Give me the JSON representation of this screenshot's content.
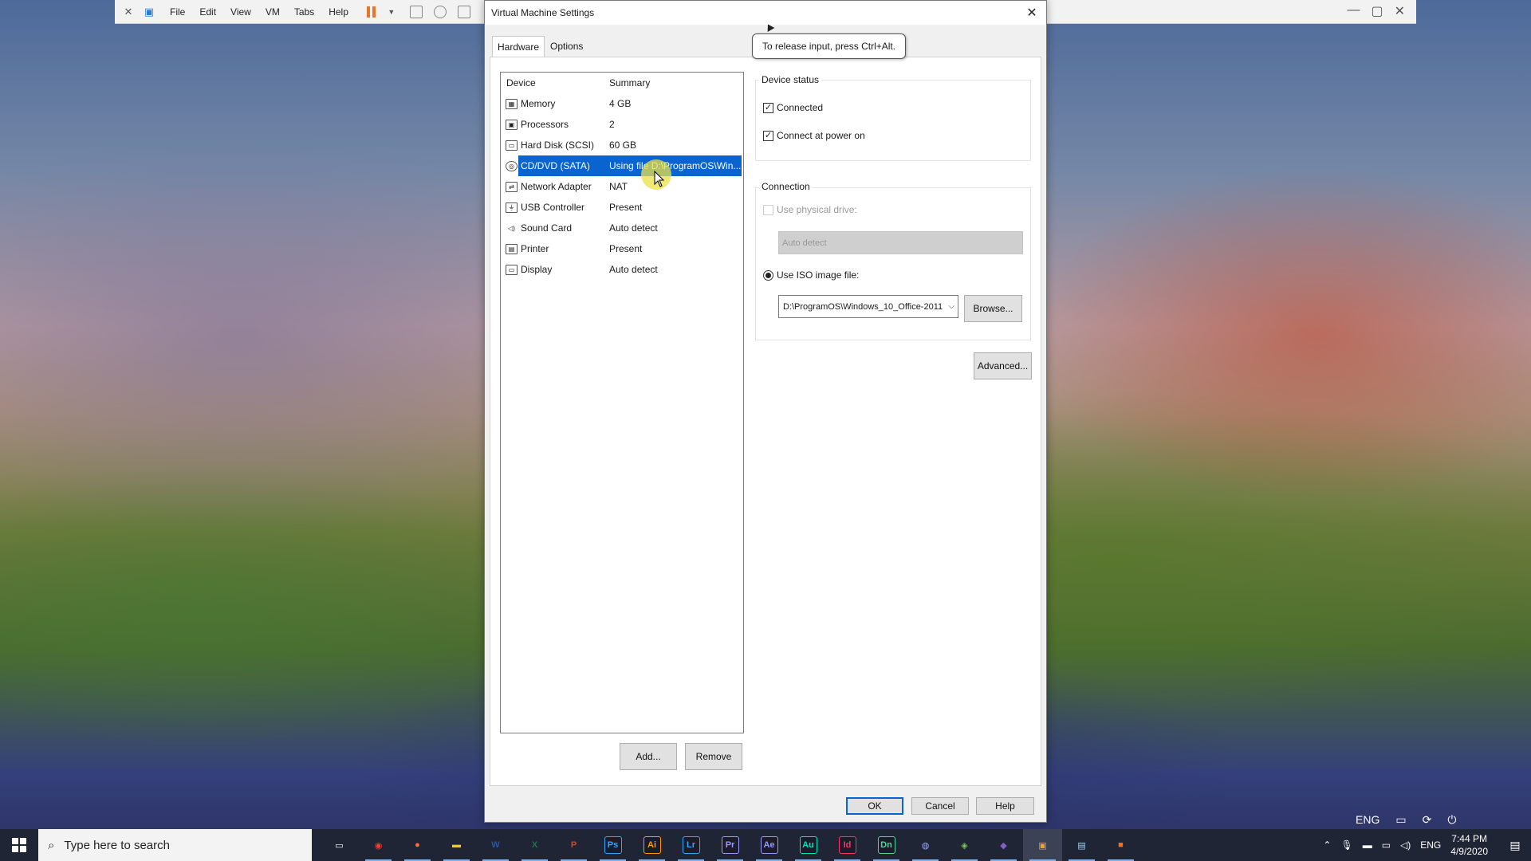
{
  "host_menu": [
    "File",
    "Edit",
    "View",
    "VM",
    "Tabs",
    "Help"
  ],
  "dialog": {
    "title": "Virtual Machine Settings",
    "tooltip": "To release input, press Ctrl+Alt.",
    "tabs": [
      {
        "label": "Hardware",
        "active": true
      },
      {
        "label": "Options",
        "active": false
      }
    ],
    "device_list": {
      "col_device": "Device",
      "col_summary": "Summary",
      "rows": [
        {
          "device": "Memory",
          "summary": "4 GB",
          "icon": "memory-icon"
        },
        {
          "device": "Processors",
          "summary": "2",
          "icon": "processor-icon"
        },
        {
          "device": "Hard Disk (SCSI)",
          "summary": "60 GB",
          "icon": "hard-disk-icon"
        },
        {
          "device": "CD/DVD (SATA)",
          "summary": "Using file D:\\ProgramOS\\Win...",
          "icon": "cd-dvd-icon",
          "selected": true
        },
        {
          "device": "Network Adapter",
          "summary": "NAT",
          "icon": "network-adapter-icon"
        },
        {
          "device": "USB Controller",
          "summary": "Present",
          "icon": "usb-icon"
        },
        {
          "device": "Sound Card",
          "summary": "Auto detect",
          "icon": "speaker-icon"
        },
        {
          "device": "Printer",
          "summary": "Present",
          "icon": "printer-icon"
        },
        {
          "device": "Display",
          "summary": "Auto detect",
          "icon": "display-icon"
        }
      ]
    },
    "add_label": "Add...",
    "remove_label": "Remove",
    "device_status": {
      "label": "Device status",
      "connected": {
        "label": "Connected",
        "checked": true
      },
      "connect_power_on": {
        "label": "Connect at power on",
        "checked": true
      }
    },
    "connection": {
      "label": "Connection",
      "physical": {
        "label": "Use physical drive:",
        "value": "Auto detect",
        "enabled": false
      },
      "iso": {
        "label": "Use ISO image file:",
        "value": "D:\\ProgramOS\\Windows_10_Office-2011",
        "selected": true
      },
      "browse_label": "Browse..."
    },
    "advanced_label": "Advanced...",
    "ok_label": "OK",
    "cancel_label": "Cancel",
    "help_label": "Help"
  },
  "taskbar": {
    "search_placeholder": "Type here to search",
    "apps": [
      {
        "name": "task-view",
        "glyph": "▭",
        "color": "#ffffff"
      },
      {
        "name": "chrome",
        "glyph": "◉",
        "color": "#ea4335"
      },
      {
        "name": "firefox",
        "glyph": "●",
        "color": "#ff7139"
      },
      {
        "name": "file-explorer",
        "glyph": "▬",
        "color": "#f4c542"
      },
      {
        "name": "word",
        "glyph": "W",
        "color": "#2b579a"
      },
      {
        "name": "excel",
        "glyph": "X",
        "color": "#217346"
      },
      {
        "name": "powerpoint",
        "glyph": "P",
        "color": "#d24726"
      },
      {
        "name": "photoshop",
        "glyph": "Ps",
        "color": "#31a8ff"
      },
      {
        "name": "illustrator",
        "glyph": "Ai",
        "color": "#ff9a00"
      },
      {
        "name": "lightroom",
        "glyph": "Lr",
        "color": "#31a8ff"
      },
      {
        "name": "premiere",
        "glyph": "Pr",
        "color": "#9999ff"
      },
      {
        "name": "after-effects",
        "glyph": "Ae",
        "color": "#9999ff"
      },
      {
        "name": "audition",
        "glyph": "Au",
        "color": "#00e4bb"
      },
      {
        "name": "indesign",
        "glyph": "Id",
        "color": "#ff3366"
      },
      {
        "name": "dimension",
        "glyph": "Dn",
        "color": "#4ed896"
      },
      {
        "name": "cinema4d",
        "glyph": "◍",
        "color": "#9aa6ff"
      },
      {
        "name": "android-studio",
        "glyph": "◈",
        "color": "#78c257"
      },
      {
        "name": "visual-studio",
        "glyph": "◆",
        "color": "#865fc5"
      },
      {
        "name": "vmware",
        "glyph": "▣",
        "color": "#f0a030",
        "active": true
      },
      {
        "name": "notepad",
        "glyph": "▤",
        "color": "#9fd3f0"
      },
      {
        "name": "app-orange",
        "glyph": "■",
        "color": "#f07020"
      }
    ],
    "language": "ENG",
    "time": "7:44 PM",
    "date": "4/9/2020"
  },
  "overlay_language": "ENG"
}
